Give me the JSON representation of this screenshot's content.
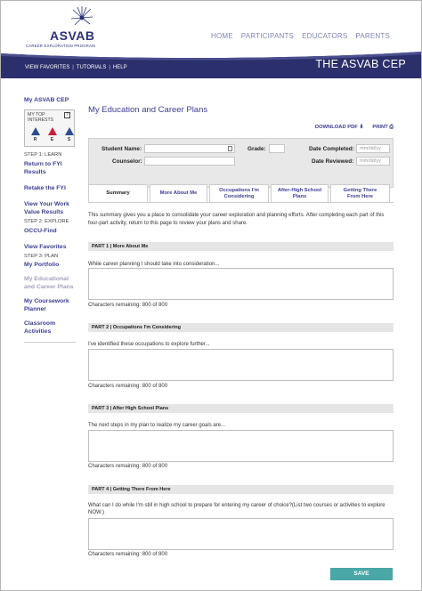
{
  "brand": {
    "logo_text": "ASVAB",
    "logo_sub": "CAREER EXPLORATION PROGRAM",
    "banner_title": "THE ASVAB CEP",
    "accent": "#2b2f6b",
    "link_color": "#3d3d94",
    "save_color": "#4aa7a7"
  },
  "topnav": [
    "HOME",
    "PARTICIPANTS",
    "EDUCATORS",
    "PARENTS"
  ],
  "subnav": [
    "VIEW FAVORITES",
    "TUTORIALS",
    "HELP"
  ],
  "sidebar": {
    "my_asvab": "My ASVAB CEP",
    "interests_label_1": "MY TOP",
    "interests_label_2": "INTERESTS",
    "help_q": "?",
    "interests": [
      "R",
      "E",
      "S"
    ],
    "step1": "STEP 1: LEARN",
    "return_fyi": "Return to FYI Results",
    "retake_fyi": "Retake the FYI",
    "view_work": "View Your Work Value Results",
    "step2": "STEP 2: EXPLORE",
    "occu_find": "OCCU-Find",
    "view_favorites": "View Favorites",
    "step3": "STEP 3: PLAN",
    "my_portfolio": "My Portfolio",
    "my_edu_plans": "My Educational and Career Plans",
    "my_coursework": "My Coursework Planner",
    "classroom": "Classroom Activities"
  },
  "main": {
    "title": "My Education and Career Plans",
    "download_pdf": "DOWNLOAD PDF",
    "print": "PRINT",
    "form": {
      "student_name_label": "Student Name:",
      "grade_label": "Grade:",
      "date_completed_label": "Date Completed:",
      "date_completed_placeholder": "mm/dd/yy",
      "counselor_label": "Counselor:",
      "date_reviewed_label": "Date Reviewed:",
      "date_reviewed_placeholder": "mm/dd/yy"
    },
    "tabs": [
      {
        "label": "Summary"
      },
      {
        "label": "More About Me"
      },
      {
        "label": "Occupations I'm Considering"
      },
      {
        "label": "After-High School Plans"
      },
      {
        "label": "Getting There From Here"
      }
    ],
    "intro": "This summary gives you a place to consolidate your career exploration and planning efforts. After completing each part of this four-part activity, return to this page to review your plans and share.",
    "parts": [
      {
        "heading": "PART 1 | More About Me",
        "prompt": "While career planning I should take into consideration...",
        "chars": "Characters remaining: 800 of 800"
      },
      {
        "heading": "PART 2 | Occupations I'm Considering",
        "prompt": "I've identified these occupations to explore further...",
        "chars": "Characters remaining: 800 of 800"
      },
      {
        "heading": "PART 3 | After High School Plans",
        "prompt": "The next steps in my plan to realize my career goals are...",
        "chars": "Characters remaining: 800 of 800"
      },
      {
        "heading": "PART 4 | Getting There From Here",
        "prompt": "What can I do while I'm still in high school to prepare for entering my career of choice?(List two courses or activities to explore NOW.)",
        "chars": "Characters remaining: 800 of 800"
      }
    ],
    "save": "SAVE"
  }
}
